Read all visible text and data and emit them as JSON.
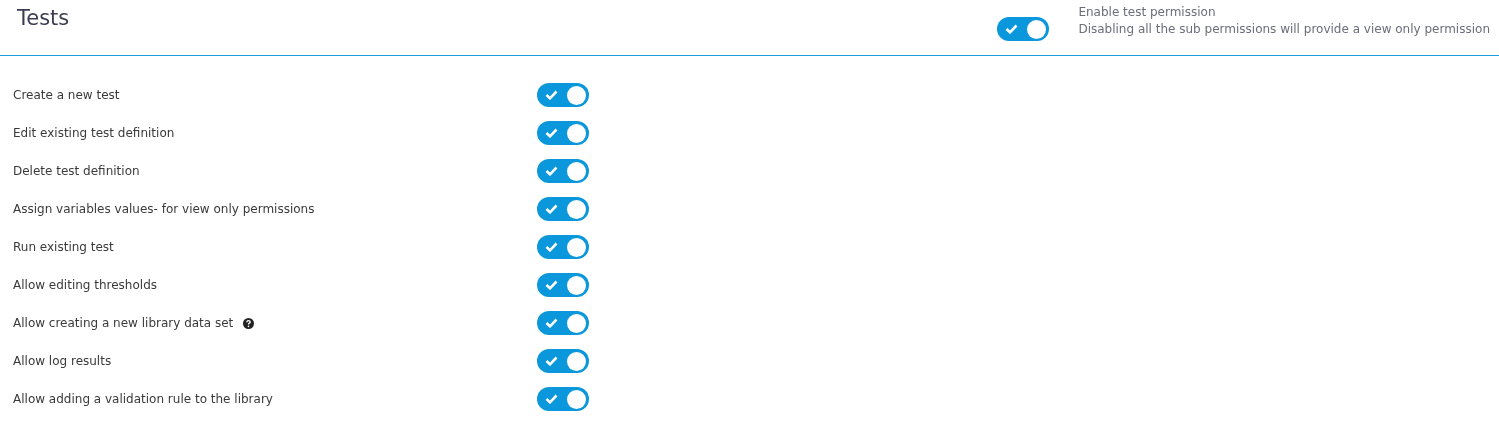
{
  "title": "Tests",
  "master": {
    "label": "Enable test permission",
    "hint": "Disabling all the sub permissions will provide a view only permission",
    "on": true
  },
  "permissions": [
    {
      "label": "Create a new test",
      "on": true,
      "help": false
    },
    {
      "label": "Edit existing test definition",
      "on": true,
      "help": false
    },
    {
      "label": "Delete test definition",
      "on": true,
      "help": false
    },
    {
      "label": "Assign variables values- for view only permissions",
      "on": true,
      "help": false
    },
    {
      "label": "Run existing test",
      "on": true,
      "help": false
    },
    {
      "label": "Allow editing thresholds",
      "on": true,
      "help": false
    },
    {
      "label": "Allow creating a new library data set",
      "on": true,
      "help": true
    },
    {
      "label": "Allow log results",
      "on": true,
      "help": false
    },
    {
      "label": "Allow adding a validation rule to the library",
      "on": true,
      "help": false
    }
  ]
}
